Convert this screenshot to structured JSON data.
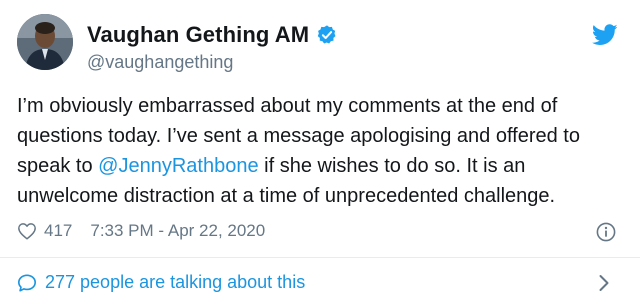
{
  "user": {
    "display_name": "Vaughan Gething AM",
    "handle": "@vaughangething"
  },
  "tweet": {
    "text_before": "I’m obviously embarrassed about my comments at the end of questions today. I’ve sent a message apologising and offered to speak to ",
    "mention": "@JennyRathbone",
    "text_after": " if she wishes to do so. It is an unwelcome distraction at a time of unprecedented challenge."
  },
  "meta": {
    "likes": "417",
    "timestamp": "7:33 PM - Apr 22, 2020"
  },
  "talking": {
    "label": "277 people are talking about this"
  },
  "icons": {
    "verified": "verified-badge-icon",
    "twitter": "twitter-bird-icon",
    "like": "heart-icon",
    "info": "info-icon",
    "talk": "speech-bubble-icon",
    "more": "chevron-right-icon"
  },
  "colors": {
    "brand_blue": "#1da1f2",
    "link_blue": "#1b95e0",
    "secondary_text": "#657786",
    "primary_text": "#14171a"
  }
}
